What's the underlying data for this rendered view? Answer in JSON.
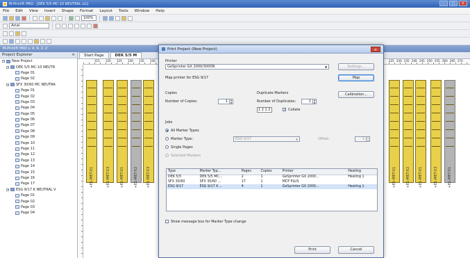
{
  "window": {
    "title": "M-Print® PRO - [DEK 5/5 MC-10 NEUTRAL LG]"
  },
  "menu": [
    "File",
    "Edit",
    "View",
    "Insert",
    "Shape",
    "Format",
    "Layout",
    "Tools",
    "Window",
    "Help"
  ],
  "toolbar": {
    "zoom": "100%",
    "font": "Arial"
  },
  "statusline": {
    "text": "M-Print® PRO v. 4. 9. 2. 2"
  },
  "explorer": {
    "title": "Project Explorer",
    "items": [
      {
        "label": "New Project",
        "level": 0,
        "type": "folder"
      },
      {
        "label": "DEK 5/5 MC-10 NEUTR",
        "level": 1,
        "type": "folder"
      },
      {
        "label": "Page 01",
        "level": 2,
        "type": "page"
      },
      {
        "label": "Page 02",
        "level": 2,
        "type": "page"
      },
      {
        "label": "SFX 30/60 MC NEUTRA",
        "level": 1,
        "type": "folder"
      },
      {
        "label": "Page 01",
        "level": 2,
        "type": "page"
      },
      {
        "label": "Page 02",
        "level": 2,
        "type": "page"
      },
      {
        "label": "Page 03",
        "level": 2,
        "type": "page"
      },
      {
        "label": "Page 04",
        "level": 2,
        "type": "page"
      },
      {
        "label": "Page 05",
        "level": 2,
        "type": "page"
      },
      {
        "label": "Page 06",
        "level": 2,
        "type": "page"
      },
      {
        "label": "Page 07",
        "level": 2,
        "type": "page"
      },
      {
        "label": "Page 08",
        "level": 2,
        "type": "page"
      },
      {
        "label": "Page 09",
        "level": 2,
        "type": "page"
      },
      {
        "label": "Page 10",
        "level": 2,
        "type": "page"
      },
      {
        "label": "Page 11",
        "level": 2,
        "type": "page"
      },
      {
        "label": "Page 12",
        "level": 2,
        "type": "page"
      },
      {
        "label": "Page 13",
        "level": 2,
        "type": "page"
      },
      {
        "label": "Page 14",
        "level": 2,
        "type": "page"
      },
      {
        "label": "Page 15",
        "level": 2,
        "type": "page"
      },
      {
        "label": "Page 16",
        "level": 2,
        "type": "page"
      },
      {
        "label": "Page 17",
        "level": 2,
        "type": "page"
      },
      {
        "label": "ESG 9/17 K NEUTRAL V",
        "level": 1,
        "type": "folder"
      },
      {
        "label": "Page 01",
        "level": 2,
        "type": "page"
      },
      {
        "label": "Page 02",
        "level": 2,
        "type": "page"
      },
      {
        "label": "Page 03",
        "level": 2,
        "type": "page"
      },
      {
        "label": "Page 04",
        "level": 2,
        "type": "page"
      }
    ]
  },
  "tabs": [
    {
      "label": "Start Page",
      "active": false
    },
    {
      "label": "DEK 5/5 M",
      "active": true
    }
  ],
  "canvas": {
    "stripe_labels": [
      "+E1-MET-X1",
      "+E1-MET-X3",
      "+E1-MET-X1",
      "+E1-MET-X2",
      "+E1-MET-X3",
      "+E1-MET-X1",
      "+E1-MET-X2"
    ],
    "ruler_marks": [
      "115",
      "120",
      "125",
      "130",
      "135",
      "140",
      "225",
      "230",
      "235",
      "240",
      "245",
      "250",
      "255",
      "260",
      "265",
      "270"
    ]
  },
  "dialog": {
    "title": "Print Project (New Project)",
    "printer_label": "Printer",
    "printer_value": "GeSprinter GX 2000/3000N",
    "settings_btn": "Settings...",
    "map_text": "Map printer for ESG 9/17",
    "map_btn": "Map",
    "copies_label": "Copies",
    "num_copies_label": "Number of Copies:",
    "num_copies_value": "1",
    "dup_label": "Duplicate Markers",
    "num_dup_label": "Number of Duplicates:",
    "num_dup_value": "1",
    "collate_label": "Collate",
    "collate_checked": true,
    "calibration_btn": "Calibration...",
    "jobs_label": "Jobs",
    "radio_all": "All Marker Types",
    "radio_marker": "Marker Type:",
    "radio_single": "Single Pages",
    "radio_selected": "Selected Markers",
    "marker_type_value": "ESG 9/17",
    "offset_label": "Offset:",
    "offset_value": "1",
    "table": {
      "headers": [
        "Type",
        "Marker Typ...",
        "Pages",
        "Copies",
        "Printer",
        "Heating"
      ],
      "rows": [
        [
          "DEK 5/5",
          "DEK 5/5 MC...",
          "2",
          "1",
          "GeSprinter GX 2000...",
          "Heating 1"
        ],
        [
          "SFX 30/60",
          "SFX 30/60 ...",
          "17",
          "1",
          "MCP PLUS",
          ""
        ],
        [
          "ESG 9/17",
          "ESG 9/17 K ...",
          "4",
          "1",
          "GeSprinter GX 2000...",
          "Heating 1"
        ]
      ]
    },
    "show_msg_label": "Show message box for Marker Type change",
    "print_btn": "Print",
    "cancel_btn": "Cancel"
  }
}
